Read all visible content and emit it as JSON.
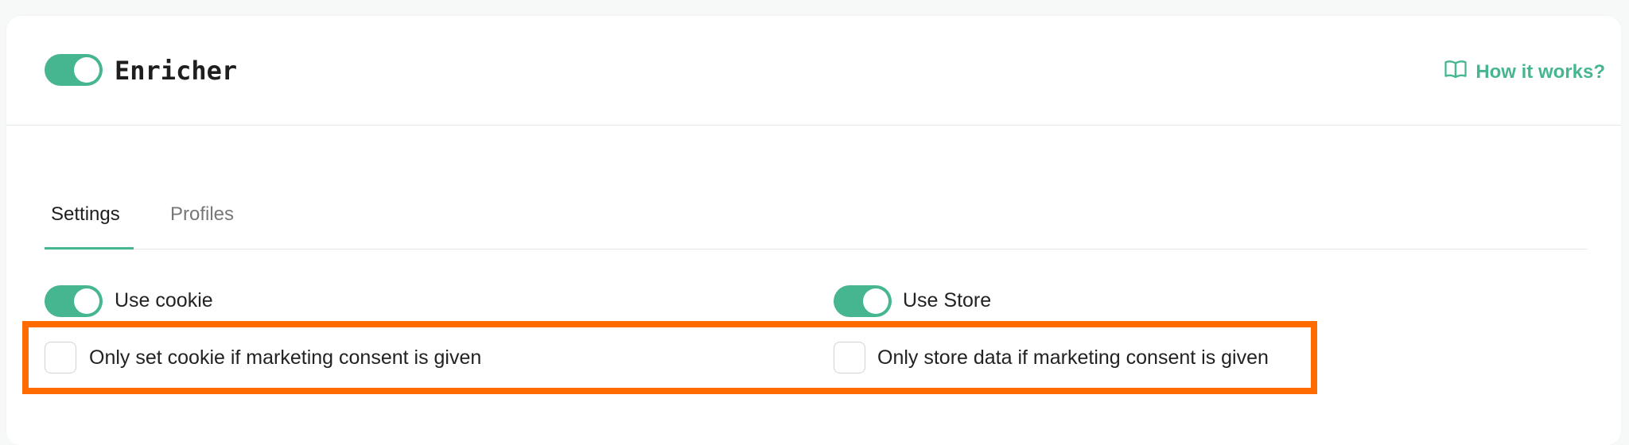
{
  "plugin": {
    "title": "Enricher",
    "enabled": true,
    "how_it_works": "How it works?",
    "how_icon": "book-open-icon"
  },
  "tabs": [
    {
      "label": "Settings",
      "active": true
    },
    {
      "label": "Profiles",
      "active": false
    }
  ],
  "settings": {
    "use_cookie": {
      "label": "Use cookie",
      "enabled": true
    },
    "use_store": {
      "label": "Use Store",
      "enabled": true
    },
    "cookie_consent": {
      "label": "Only set cookie if marketing consent is given",
      "checked": false
    },
    "store_consent": {
      "label": "Only store data if marketing consent is given",
      "checked": false
    }
  },
  "colors": {
    "accent": "#46b690",
    "highlight": "#ff6b00"
  }
}
